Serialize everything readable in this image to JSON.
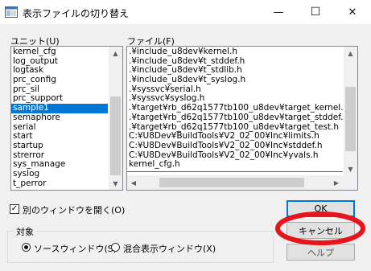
{
  "window": {
    "title": "表示ファイルの切り替え",
    "min_glyph": "—",
    "max_glyph": "☐",
    "close_glyph": "✕"
  },
  "unit_panel": {
    "label": "ユニット(U)",
    "items": [
      "kernel_cfg",
      "log_output",
      "logtask",
      "prc_config",
      "prc_sil",
      "prc_support",
      "sample1",
      "semaphore",
      "serial",
      "start",
      "startup",
      "strerror",
      "sys_manage",
      "syslog",
      "t_perror"
    ],
    "selected_index": 6
  },
  "file_panel": {
    "label": "ファイル(F)",
    "items": [
      ".¥include_u8dev¥kernel.h",
      ".¥include_u8dev¥t_stddef.h",
      ".¥include_u8dev¥t_stdlib.h",
      ".¥include_u8dev¥t_syslog.h",
      ".¥syssvc¥serial.h",
      ".¥syssvc¥syslog.h",
      ".¥target¥rb_d62q1577tb100_u8dev¥target_kernel.h",
      ".¥target¥rb_d62q1577tb100_u8dev¥target_stddef.h",
      ".¥target¥rb_d62q1577tb100_u8dev¥target_test.h",
      "C:¥U8Dev¥BuildTools¥V2_02_00¥Inc¥limits.h",
      "C:¥U8Dev¥BuildTools¥V2_02_00¥Inc¥stddef.h",
      "C:¥U8Dev¥BuildTools¥V2_02_00¥Inc¥yvals.h",
      "kernel_cfg.h"
    ]
  },
  "options": {
    "open_new_window_label": "別のウィンドウを開く(O)",
    "open_new_window_checked": true,
    "target_group_label": "対象",
    "radio_source": "ソースウィンドウ(S)",
    "radio_mixed": "混合表示ウィンドウ(X)",
    "selected_radio": "source"
  },
  "buttons": {
    "ok": "OK",
    "cancel": "キャンセル",
    "help": "ヘルプ"
  },
  "annotation": {
    "color": "#e8141b",
    "target": "cancel-button"
  }
}
